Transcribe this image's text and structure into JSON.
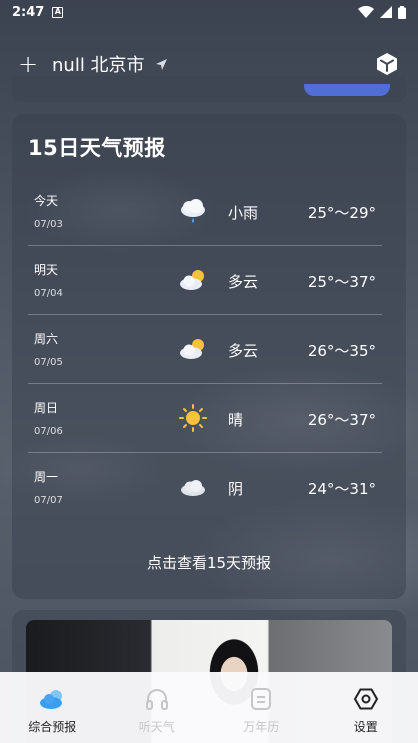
{
  "status_bar": {
    "time": "2:47",
    "notif_letter": "A"
  },
  "header": {
    "add_label": "+",
    "city": "null 北京市"
  },
  "forecast": {
    "title": "15日天气预报",
    "days": [
      {
        "name": "今天",
        "date": "07/03",
        "condition": "小雨",
        "temp": "25°～29°",
        "icon": "light-rain-icon"
      },
      {
        "name": "明天",
        "date": "07/04",
        "condition": "多云",
        "temp": "25°～37°",
        "icon": "partly-cloudy-icon"
      },
      {
        "name": "周六",
        "date": "07/05",
        "condition": "多云",
        "temp": "26°～35°",
        "icon": "partly-cloudy-icon"
      },
      {
        "name": "周日",
        "date": "07/06",
        "condition": "晴",
        "temp": "26°～37°",
        "icon": "sunny-icon"
      },
      {
        "name": "周一",
        "date": "07/07",
        "condition": "阴",
        "temp": "24°～31°",
        "icon": "cloudy-icon"
      }
    ],
    "more_link": "点击查看15天预报"
  },
  "bottom_nav": [
    {
      "label": "综合预报",
      "icon": "cloud-weather-icon",
      "active": true
    },
    {
      "label": "听天气",
      "icon": "headphones-icon",
      "active": false
    },
    {
      "label": "万年历",
      "icon": "calendar-icon",
      "active": false
    },
    {
      "label": "设置",
      "icon": "settings-hexagon-icon",
      "active": true
    }
  ],
  "colors": {
    "accent_blue": "#4aa3f0",
    "pill_blue": "#4f6fd6",
    "sun_yellow": "#f7c23b"
  }
}
